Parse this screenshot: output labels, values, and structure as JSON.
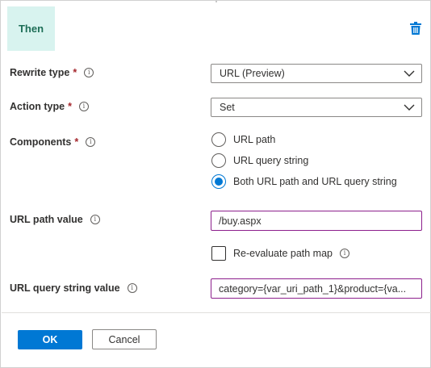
{
  "header": {
    "badge_label": "Then",
    "delete_icon": "trash-icon"
  },
  "fields": {
    "rewrite_type": {
      "label": "Rewrite type",
      "required": "*",
      "value": "URL (Preview)"
    },
    "action_type": {
      "label": "Action type",
      "required": "*",
      "value": "Set"
    },
    "components": {
      "label": "Components",
      "required": "*",
      "options": [
        {
          "label": "URL path",
          "checked": false
        },
        {
          "label": "URL query string",
          "checked": false
        },
        {
          "label": "Both URL path and URL query string",
          "checked": true
        }
      ]
    },
    "url_path_value": {
      "label": "URL path value",
      "value": "/buy.aspx"
    },
    "reevaluate": {
      "label": "Re-evaluate path map",
      "checked": false
    },
    "url_query_string_value": {
      "label": "URL query string value",
      "value": "category={var_uri_path_1}&product={va..."
    }
  },
  "footer": {
    "ok_label": "OK",
    "cancel_label": "Cancel"
  },
  "colors": {
    "primary": "#0078d4",
    "badge_bg": "#d8f3ef",
    "badge_text": "#1e6e57",
    "required": "#a4262c",
    "input_border_focus": "#8c1f8c"
  }
}
